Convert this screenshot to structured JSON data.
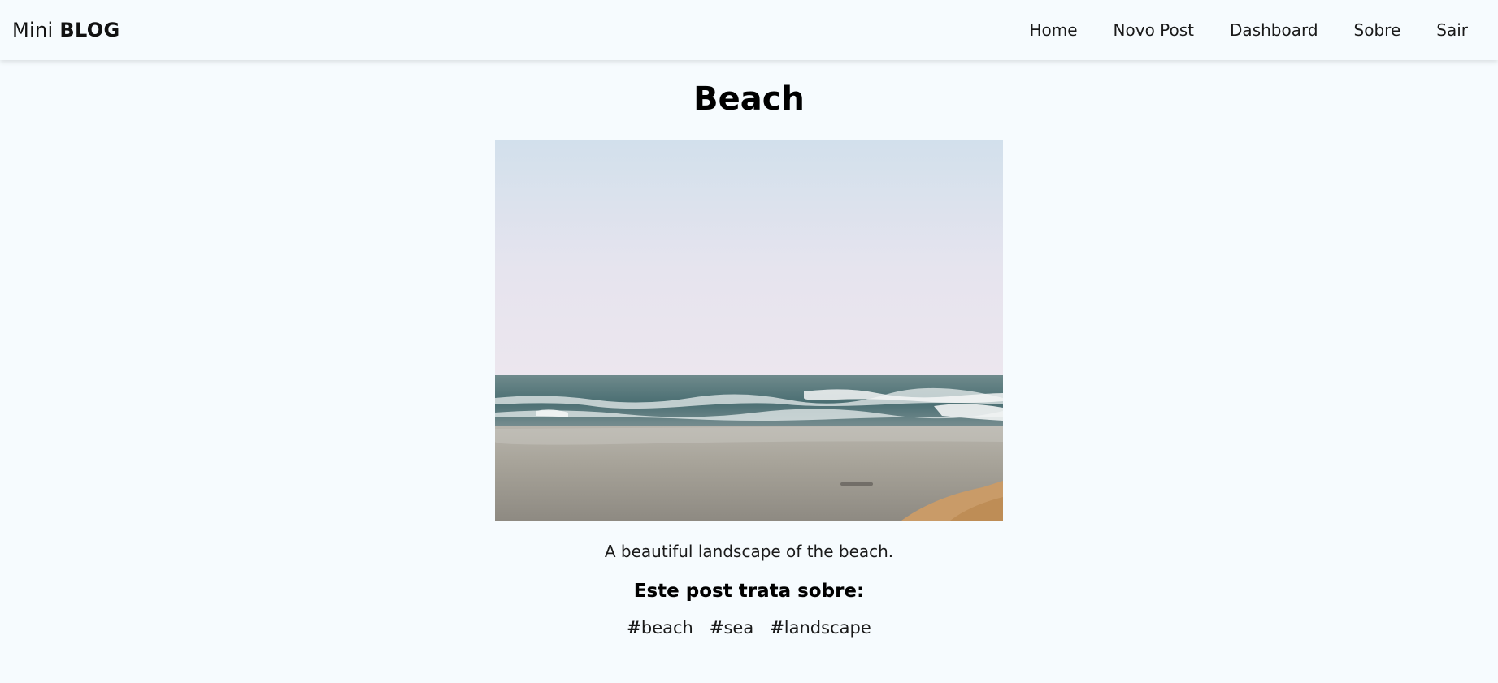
{
  "navbar": {
    "brand_light": "Mini",
    "brand_bold": "BLOG",
    "links": [
      "Home",
      "Novo Post",
      "Dashboard",
      "Sobre",
      "Sair"
    ]
  },
  "post": {
    "title": "Beach",
    "image_alt": "beach landscape photo",
    "body": "A beautiful landscape of the beach.",
    "tags_heading": "Este post trata sobre:",
    "tags": [
      "beach",
      "sea",
      "landscape"
    ]
  },
  "colors": {
    "background": "#f6fbfe",
    "text": "#111111"
  }
}
